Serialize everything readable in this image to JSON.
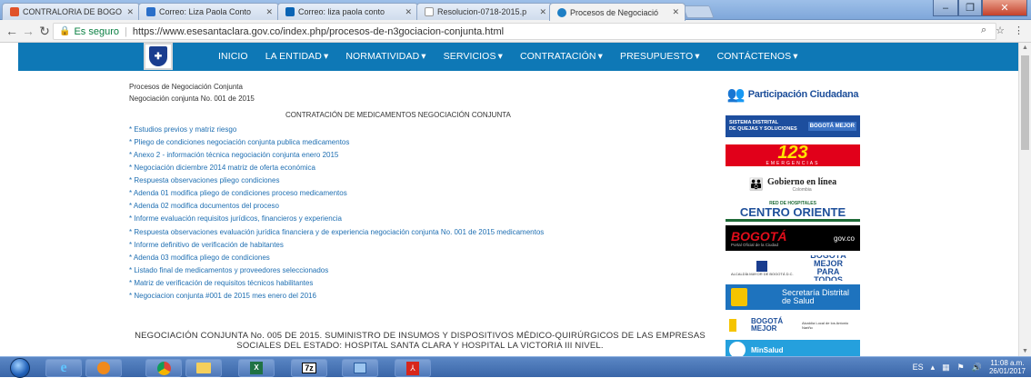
{
  "browser": {
    "tabs": [
      {
        "title": "CONTRALORIA DE BOGO",
        "favicon": "contraloria-icon",
        "color": "#e0522a"
      },
      {
        "title": "Correo: Liza Paola Conto",
        "favicon": "mail-icon",
        "color": "#2a6fc9"
      },
      {
        "title": "Correo: liza paola conto",
        "favicon": "outlook-icon",
        "color": "#0a64b4"
      },
      {
        "title": "Resolucion-0718-2015.p",
        "favicon": "document-icon",
        "color": "#888888"
      },
      {
        "title": "Procesos de Negociació",
        "favicon": "site-icon",
        "color": "#1f7fc4"
      }
    ],
    "window_controls": {
      "minimize": "–",
      "maximize": "❐",
      "close": "✕"
    },
    "secure_label": "Es seguro",
    "url": "https://www.esesantaclara.gov.co/index.php/procesos-de-n3gociacion-conjunta.html"
  },
  "site": {
    "menu": [
      "INICIO",
      "LA ENTIDAD",
      "NORMATIVIDAD",
      "SERVICIOS",
      "CONTRATACIÓN",
      "PRESUPUESTO",
      "CONTÁCTENOS"
    ],
    "menu_dropdown_marker": "▾",
    "breadcrumb_title": "Procesos de Negociación Conjunta",
    "subtitle": "Negociación conjunta No. 001 de 2015",
    "section_title": "CONTRATACIÓN DE MEDICAMENTOS NEGOCIACIÓN CONJUNTA",
    "links": [
      "* Estudios previos y matriz riesgo",
      "* Pliego de condiciones negociación conjunta publica medicamentos",
      "* Anexo 2 - información técnica negociación conjunta enero 2015",
      "* Negociación diciembre 2014 matriz de oferta económica",
      "* Respuesta observaciones pliego condiciones",
      "* Adenda 01 modifica pliego de condiciones proceso medicamentos",
      "* Adenda 02 modifica documentos del proceso",
      "* Informe evaluación requisitos jurídicos, financieros y experiencia",
      "* Respuesta observaciones evaluación jurídica financiera y de experiencia negociación conjunta No. 001 de 2015 medicamentos",
      "* Informe definitivo de verificación de habitantes",
      "* Adenda 03 modifica pliego de condiciones",
      "* Listado final de medicamentos y proveedores seleccionados",
      "* Matriz de verificación de requisitos técnicos habilitantes",
      "* Negociacion conjunta #001 de 2015 mes enero del 2016"
    ],
    "big_heading": "NEGOCIACIÓN CONJUNTA No. 005 DE 2015. SUMINISTRO DE INSUMOS Y DISPOSITIVOS MÉDICO-QUIRÚRGICOS DE LAS EMPRESAS SOCIALES DEL ESTADO: HOSPITAL SANTA CLARA Y HOSPITAL LA VICTORIA III NIVEL.",
    "sidebar": {
      "participacion": "Participación Ciudadana",
      "sistema_line1": "SISTEMA DISTRITAL",
      "sistema_line2": "DE QUEJAS Y SOLUCIONES",
      "bogota_mejor": "BOGOTÁ MEJOR",
      "emergencias_num": "123",
      "emergencias_label": "EMERGENCIAS",
      "gobierno": "Gobierno en línea",
      "gobierno_sub": "Colombia",
      "red_label": "RED DE HOSPITALES",
      "red_name": "CENTRO ORIENTE",
      "bogota_gov": "BOGOTÁ",
      "bogota_gov_suffix": "gov.co",
      "bogota_gov_sub": "Portal Oficial de la Ciudad",
      "alcaldia_label": "ALCALDÍA MAYOR DE BOGOTÁ D.C.",
      "mejor_para_todos": "BOGOTÁ MEJOR PARA TODOS",
      "secretaria": "Secretaría Distrital de Salud",
      "alcaldia_local": "Alcaldía Local de los Antonio Nariño",
      "minsalud": "MinSalud"
    }
  },
  "taskbar": {
    "lang": "ES",
    "time": "11:08 a.m.",
    "date": "26/01/2017"
  }
}
